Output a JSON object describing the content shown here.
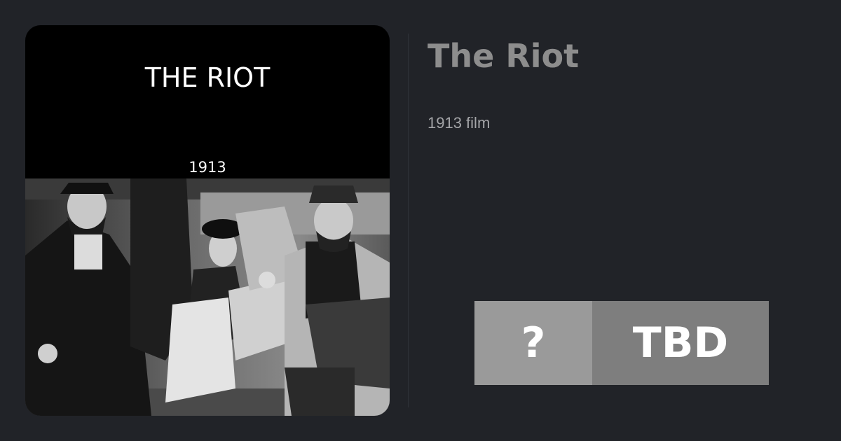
{
  "poster": {
    "title": "THE RIOT",
    "year": "1913",
    "image_icon": "film-still-photo"
  },
  "film": {
    "title": "The Riot",
    "meta": "1913 film"
  },
  "score": {
    "unknown": "?",
    "label": "TBD"
  },
  "colors": {
    "background": "#212328",
    "title": "#8d8d8d",
    "meta": "#a4a5a8",
    "score_left": "#9a9a9a",
    "score_right": "#7e7e7e"
  }
}
